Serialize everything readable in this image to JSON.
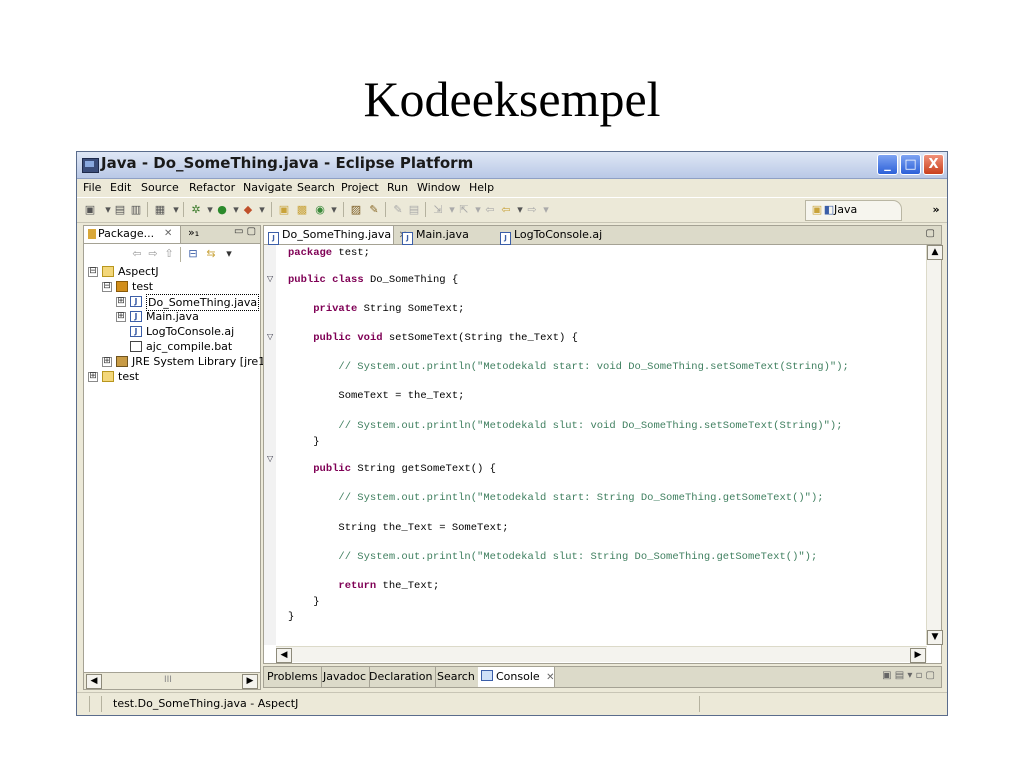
{
  "slide": {
    "title": "Kodeeksempel"
  },
  "window": {
    "title": "Java - Do_SomeThing.java - Eclipse Platform",
    "controls": {
      "minimize": "_",
      "maximize": "□",
      "close": "X"
    }
  },
  "menu": [
    "File",
    "Edit",
    "Source",
    "Refactor",
    "Navigate",
    "Search",
    "Project",
    "Run",
    "Window",
    "Help"
  ],
  "perspective": {
    "label": "Java",
    "overflow": "»"
  },
  "package_explorer": {
    "tab_label": "Package...",
    "tab_close": "✕",
    "more": "»₁",
    "tree": [
      {
        "label": "AspectJ",
        "icon": "project-icon",
        "expander": "⊟"
      },
      {
        "label": "test",
        "icon": "package-icon",
        "expander": "⊟"
      },
      {
        "label": "Do_SomeThing.java",
        "icon": "java-file-icon",
        "expander": "⊞",
        "selected": true
      },
      {
        "label": "Main.java",
        "icon": "java-file-icon",
        "expander": "⊞"
      },
      {
        "label": "LogToConsole.aj",
        "icon": "aspect-file-icon",
        "expander": ""
      },
      {
        "label": "ajc_compile.bat",
        "icon": "batch-file-icon",
        "expander": ""
      },
      {
        "label": "JRE System Library [jre1",
        "icon": "library-icon",
        "expander": "⊞"
      },
      {
        "label": "test",
        "icon": "project-icon",
        "expander": "⊞"
      }
    ],
    "scroll_thumb": "III"
  },
  "editor": {
    "tabs": [
      {
        "label": "Do_SomeThing.java",
        "close": "✕",
        "active": true
      },
      {
        "label": "Main.java",
        "active": false
      },
      {
        "label": "LogToConsole.aj",
        "active": false
      }
    ],
    "code": [
      "package test;",
      "public class Do_SomeThing {",
      "    private String SomeText;",
      "    public void setSomeText(String the_Text) {",
      "        // System.out.println(\"Metodekald start: void Do_SomeThing.setSomeText(String)\");",
      "        SomeText = the_Text;",
      "        // System.out.println(\"Metodekald slut: void Do_SomeThing.setSomeText(String)\");",
      "    }",
      "    public String getSomeText() {",
      "        // System.out.println(\"Metodekald start: String Do_SomeThing.getSomeText()\");",
      "        String the_Text = SomeText;",
      "        // System.out.println(\"Metodekald slut: String Do_SomeThing.getSomeText()\");",
      "        return the_Text;",
      "    }",
      "}"
    ]
  },
  "bottom_tabs": [
    "Problems",
    "Javadoc",
    "Declaration",
    "Search",
    "Console"
  ],
  "bottom_console_close": "✕",
  "status": {
    "text": "test.Do_SomeThing.java - AspectJ"
  }
}
